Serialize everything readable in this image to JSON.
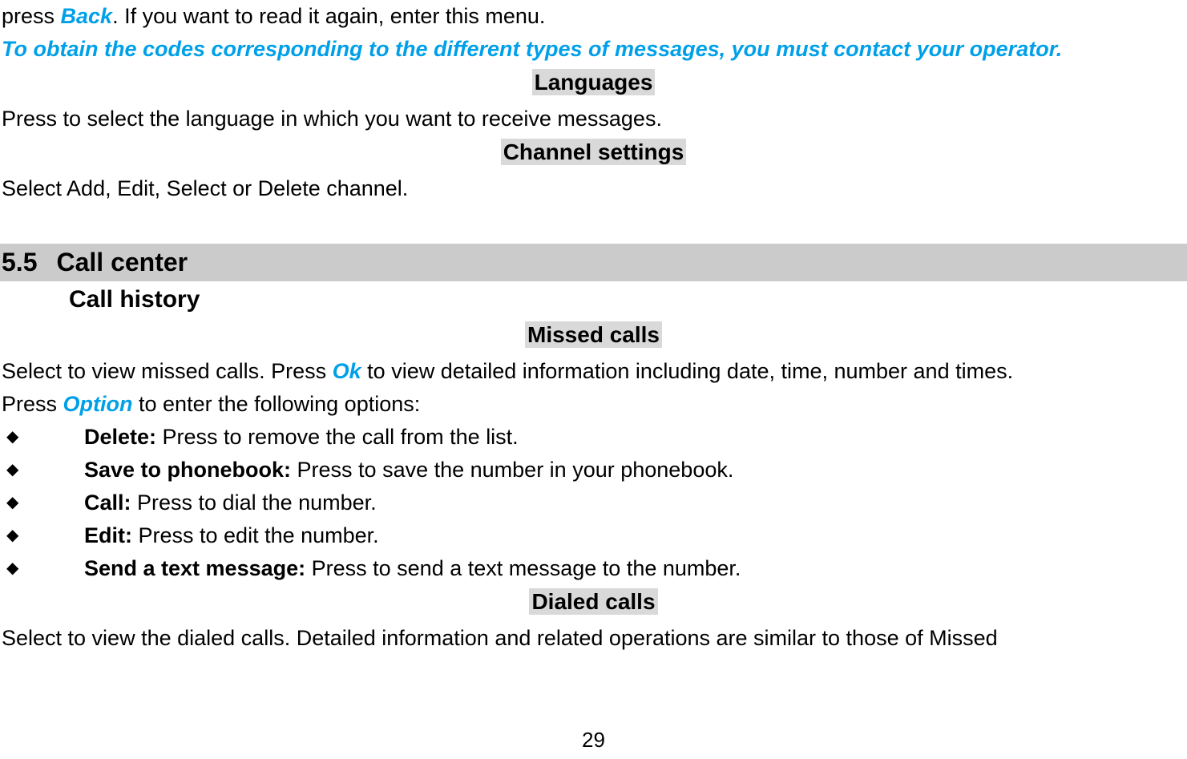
{
  "document": {
    "page_number": "29",
    "accent_color": "#00A0E9",
    "highlight_color": "#D9D9D9",
    "band_color": "#CBCBCB"
  },
  "top": {
    "line1_prefix": "press ",
    "line1_link": "Back",
    "line1_suffix": ". If you want to read it again, enter this menu.",
    "emphasis": "To obtain the codes corresponding to the different types of messages, you must contact your operator."
  },
  "languages": {
    "heading": "Languages",
    "body": "Press to select the language in which you want to receive messages."
  },
  "channel_settings": {
    "heading": "Channel settings",
    "body": "Select Add, Edit, Select or Delete channel."
  },
  "section": {
    "number": "5.5",
    "title": "Call center",
    "subsection": "Call history"
  },
  "missed_calls": {
    "heading": "Missed calls",
    "body_part1": "Select to view missed calls. Press ",
    "body_link1": "Ok",
    "body_part2": " to view detailed information including date, time, number and times.",
    "body_part3": "Press ",
    "body_link2": "Option",
    "body_part4": " to enter the following options:",
    "options": [
      {
        "bullet": "diamond-bullet-icon",
        "label": "Delete:",
        "text": " Press to remove the call from the list."
      },
      {
        "bullet": "diamond-bullet-icon",
        "label": "Save to phonebook:",
        "text": " Press to save the number in your phonebook."
      },
      {
        "bullet": "diamond-bullet-icon",
        "label": "Call:",
        "text": " Press to dial the number."
      },
      {
        "bullet": "diamond-bullet-icon",
        "label": "Edit:",
        "text": " Press to edit the number."
      },
      {
        "bullet": "diamond-bullet-icon",
        "label": "Send a text message:",
        "text": " Press to send a text message to the number."
      }
    ]
  },
  "dialed_calls": {
    "heading": "Dialed calls",
    "body": "Select to view the dialed calls. Detailed information and related operations are similar to those of Missed"
  }
}
